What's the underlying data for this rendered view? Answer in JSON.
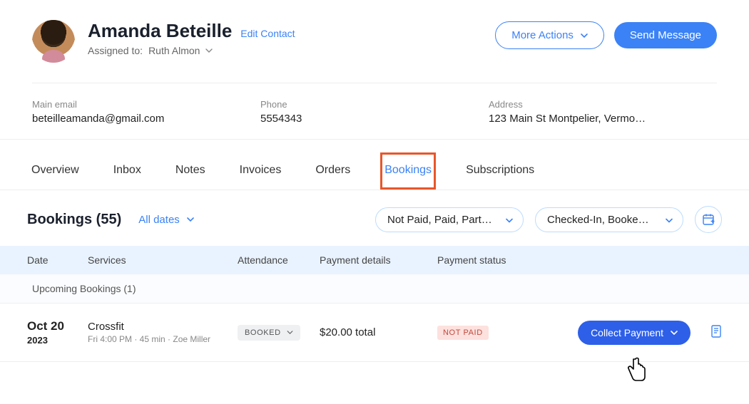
{
  "header": {
    "contact_name": "Amanda Beteille",
    "edit_label": "Edit Contact",
    "assigned_prefix": "Assigned to:",
    "assigned_name": "Ruth Almon",
    "more_actions": "More Actions",
    "send_message": "Send Message"
  },
  "info": {
    "email_label": "Main email",
    "email_value": "beteilleamanda@gmail.com",
    "phone_label": "Phone",
    "phone_value": "5554343",
    "address_label": "Address",
    "address_value": "123 Main St Montpelier, Vermo…"
  },
  "tabs": {
    "overview": "Overview",
    "inbox": "Inbox",
    "notes": "Notes",
    "invoices": "Invoices",
    "orders": "Orders",
    "bookings": "Bookings",
    "subscriptions": "Subscriptions"
  },
  "bookings": {
    "title": "Bookings (55)",
    "date_filter": "All dates",
    "pay_filter": "Not Paid, Paid, Partia…",
    "status_filter": "Checked-In, Booked,…",
    "columns": {
      "date": "Date",
      "services": "Services",
      "attendance": "Attendance",
      "payment_details": "Payment details",
      "payment_status": "Payment status"
    },
    "section": "Upcoming Bookings (1)",
    "row": {
      "date_main": "Oct 20",
      "date_year": "2023",
      "service_name": "Crossfit",
      "service_meta": "Fri 4:00 PM · 45 min · Zoe Miller",
      "attendance": "BOOKED",
      "amount": "$20.00 total",
      "status": "NOT PAID",
      "collect": "Collect Payment"
    }
  }
}
